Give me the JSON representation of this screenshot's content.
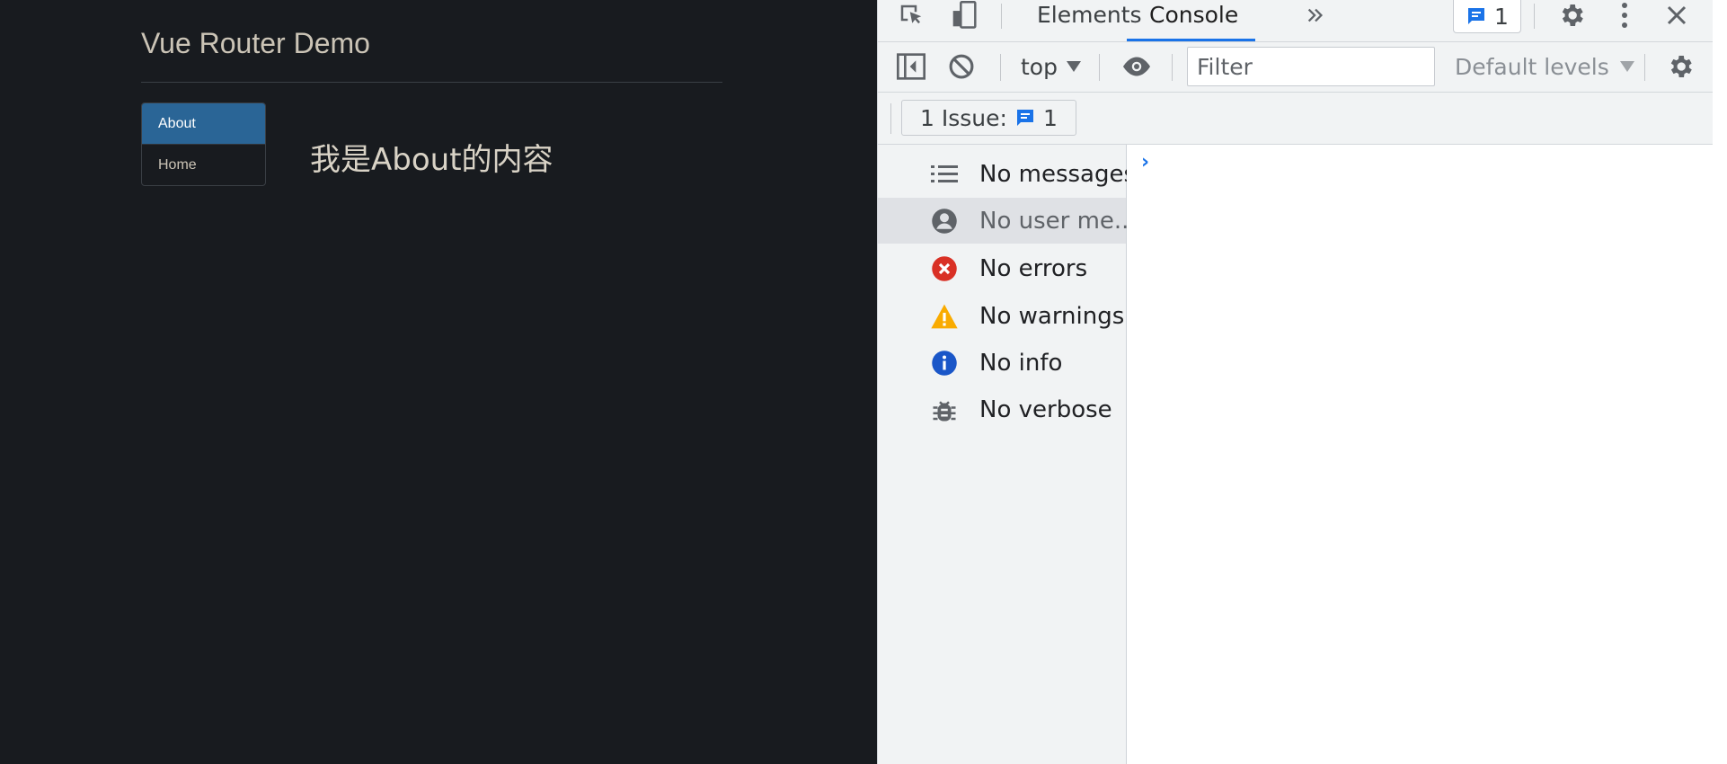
{
  "app": {
    "title": "Vue Router Demo",
    "nav": [
      {
        "label": "About",
        "active": true
      },
      {
        "label": "Home",
        "active": false
      }
    ],
    "content": "我是About的内容"
  },
  "devtools": {
    "tabs": [
      {
        "label": "Elements",
        "active": false
      },
      {
        "label": "Console",
        "active": true
      }
    ],
    "issues_count": "1",
    "toolbar": {
      "context": "top",
      "filter_placeholder": "Filter",
      "levels": "Default levels"
    },
    "issue_bar": {
      "label": "1 Issue:",
      "count": "1"
    },
    "sidebar": [
      {
        "label": "No messages",
        "icon": "list-icon"
      },
      {
        "label": "No user me...",
        "icon": "user-icon",
        "selected": true
      },
      {
        "label": "No errors",
        "icon": "error-icon"
      },
      {
        "label": "No warnings",
        "icon": "warning-icon"
      },
      {
        "label": "No info",
        "icon": "info-icon"
      },
      {
        "label": "No verbose",
        "icon": "bug-icon"
      }
    ],
    "prompt": "›",
    "colors": {
      "accent": "#1a73e8",
      "error": "#d93025",
      "warning": "#f9ab00",
      "info": "#1a56c8",
      "nav_active": "#2a6596"
    }
  }
}
